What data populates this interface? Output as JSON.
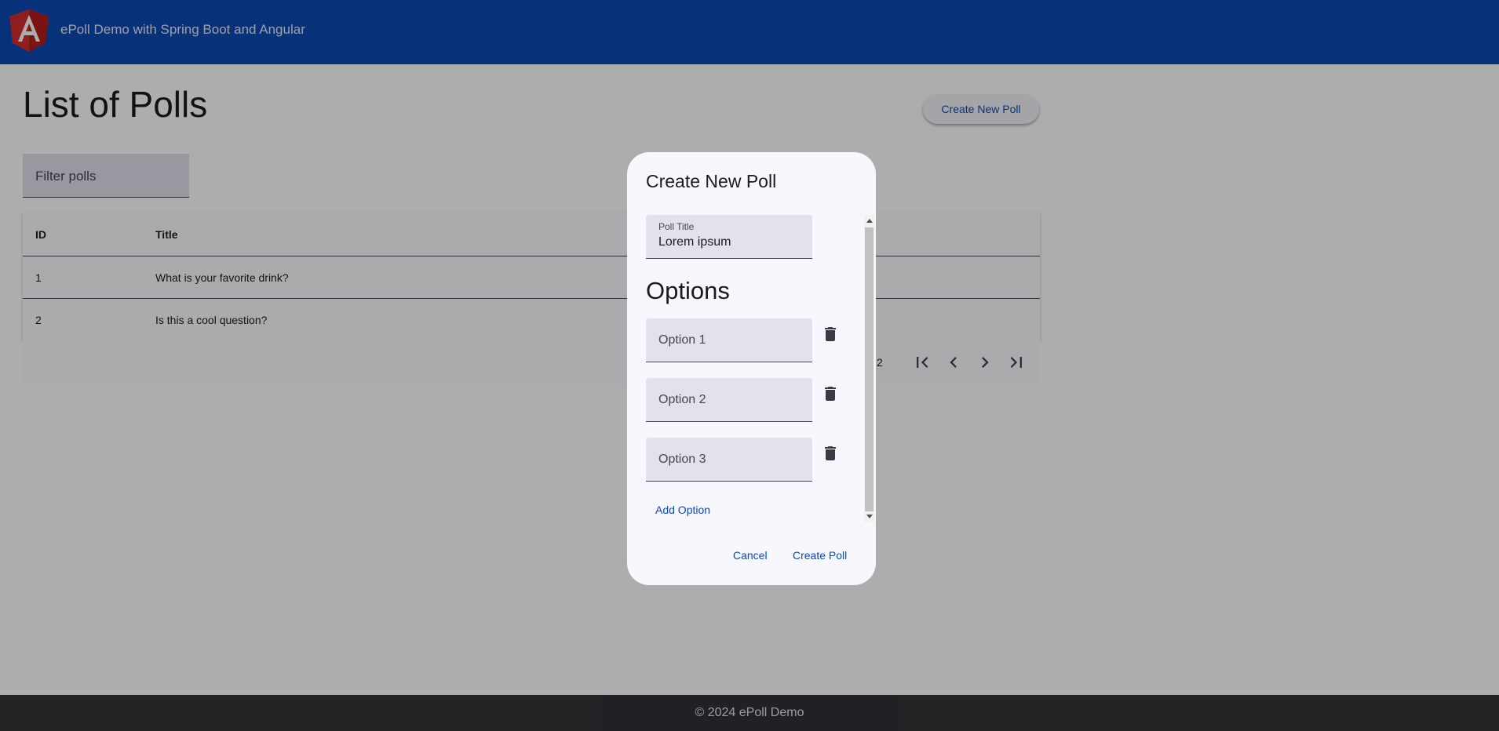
{
  "header": {
    "title": "ePoll Demo with Spring Boot and Angular"
  },
  "page": {
    "title": "List of Polls",
    "create_button": "Create New Poll",
    "filter_placeholder": "Filter polls"
  },
  "table": {
    "columns": [
      "ID",
      "Title"
    ],
    "rows": [
      {
        "id": "1",
        "title": "What is your favorite drink?"
      },
      {
        "id": "2",
        "title": "Is this a cool question?"
      }
    ]
  },
  "paginator": {
    "range_fragment": "2"
  },
  "dialog": {
    "title": "Create New Poll",
    "poll_title_label": "Poll Title",
    "poll_title_value": "Lorem ipsum",
    "options_heading": "Options",
    "options": [
      {
        "placeholder": "Option 1"
      },
      {
        "placeholder": "Option 2"
      },
      {
        "placeholder": "Option 3"
      }
    ],
    "add_option": "Add Option",
    "cancel": "Cancel",
    "submit": "Create Poll"
  },
  "footer": {
    "text": "© 2024 ePoll Demo"
  },
  "colors": {
    "primary": "#0b4bb4",
    "footer_bg": "#303235"
  },
  "icons": [
    "angular-logo-icon",
    "first-page-icon",
    "previous-page-icon",
    "next-page-icon",
    "last-page-icon",
    "trash-icon"
  ]
}
